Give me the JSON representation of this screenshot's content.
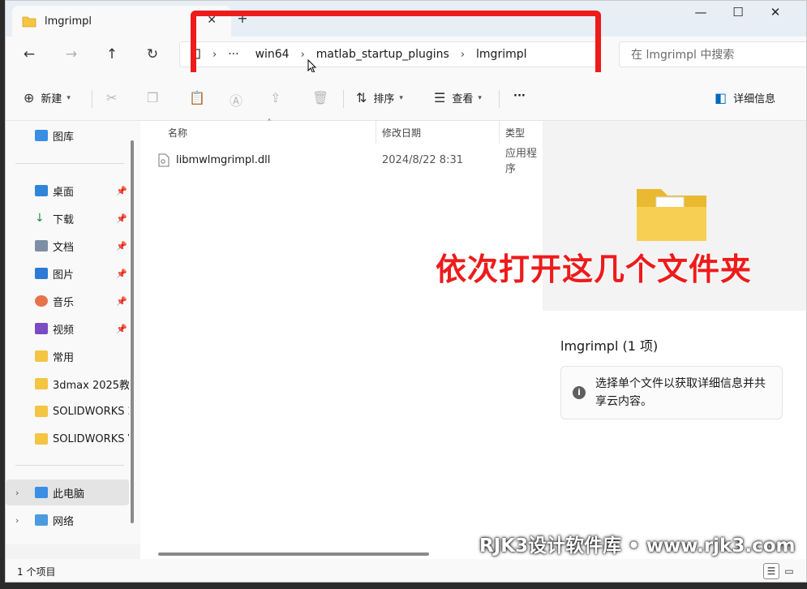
{
  "window": {
    "tab_title": "lmgrimpl",
    "tab_close": "✕",
    "new_tab": "+",
    "minimize": "—",
    "maximize": "☐",
    "close": "✕"
  },
  "nav": {
    "back": "←",
    "forward": "→",
    "up": "↑",
    "refresh": "↻",
    "breadcrumb": {
      "more": "···",
      "seg1": "win64",
      "seg2": "matlab_startup_plugins",
      "seg3": "lmgrimpl",
      "sep": "›"
    },
    "search_placeholder": "在 lmgrimpl 中搜索"
  },
  "commands": {
    "new_label": "新建",
    "sort_label": "排序",
    "view_label": "查看",
    "more": "···",
    "details_label": "详细信息"
  },
  "sidebar": {
    "gallery": "图库",
    "desktop": "桌面",
    "downloads": "下载",
    "documents": "文档",
    "pictures": "图片",
    "music": "音乐",
    "videos": "视频",
    "common": "常用",
    "folder_3dmax": "3dmax 2025教",
    "folder_sw1": "SOLIDWORKS 2",
    "folder_sw2": "SOLIDWORKS V",
    "this_pc": "此电脑",
    "network": "网络",
    "pin_icon": "📌"
  },
  "filelist": {
    "columns": {
      "name": "名称",
      "date": "修改日期",
      "type": "类型"
    },
    "files": [
      {
        "name": "libmwlmgrimpl.dll",
        "date": "2024/8/22 8:31",
        "type": "应用程序"
      }
    ]
  },
  "details": {
    "title": "lmgrimpl (1 项)",
    "info_text": "选择单个文件以获取详细信息并共享云内容。",
    "info_icon": "i"
  },
  "annotation": "依次打开这几个文件夹",
  "status": {
    "count": "1 个项目"
  },
  "watermark": "RJK3设计软件库 • www.rjk3.com",
  "colors": {
    "annotation_red": "#ee1b1b",
    "folder_yellow": "#f4c542",
    "accent_blue": "#0067c0"
  }
}
